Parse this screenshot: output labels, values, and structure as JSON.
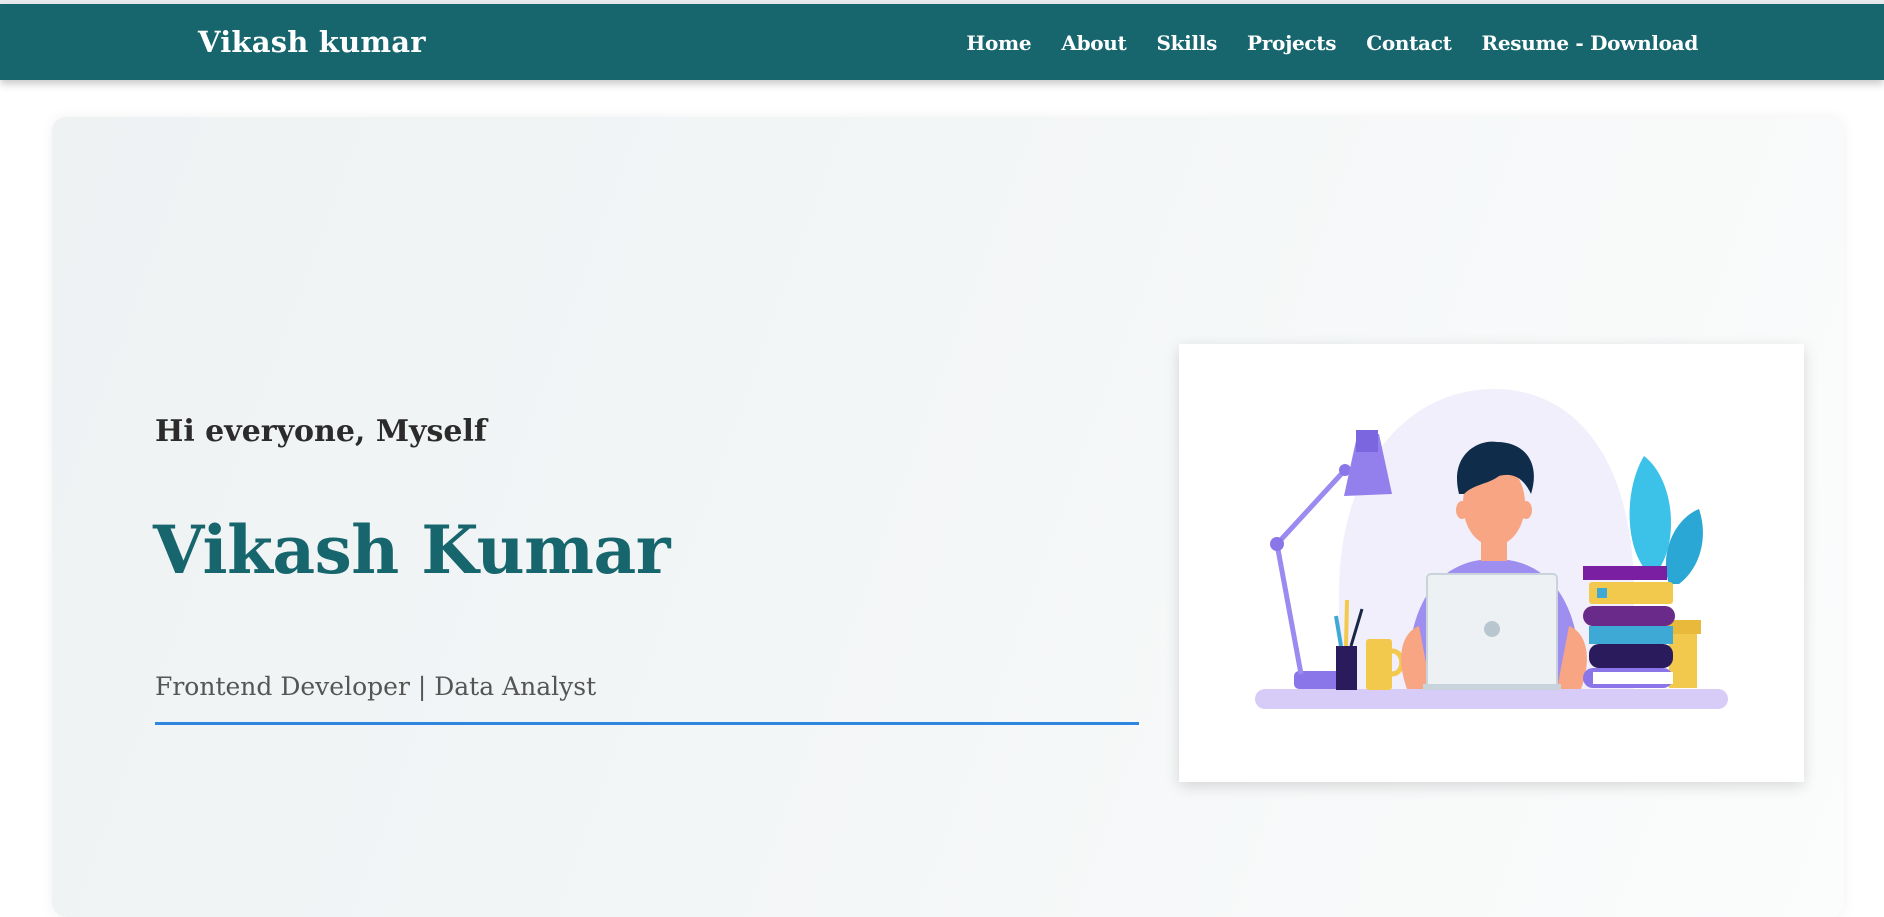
{
  "header": {
    "brand": "Vikash kumar",
    "nav": [
      "Home",
      "About",
      "Skills",
      "Projects",
      "Contact",
      "Resume - Download"
    ]
  },
  "hero": {
    "greeting": "Hi everyone, Myself",
    "name": "Vikash Kumar",
    "role": "Frontend Developer | Data Analyst"
  },
  "illustration": {
    "icon": "developer-at-desk-illustration"
  },
  "colors": {
    "navbar": "#17666d",
    "name": "#17666d",
    "underline": "#2e86de"
  }
}
